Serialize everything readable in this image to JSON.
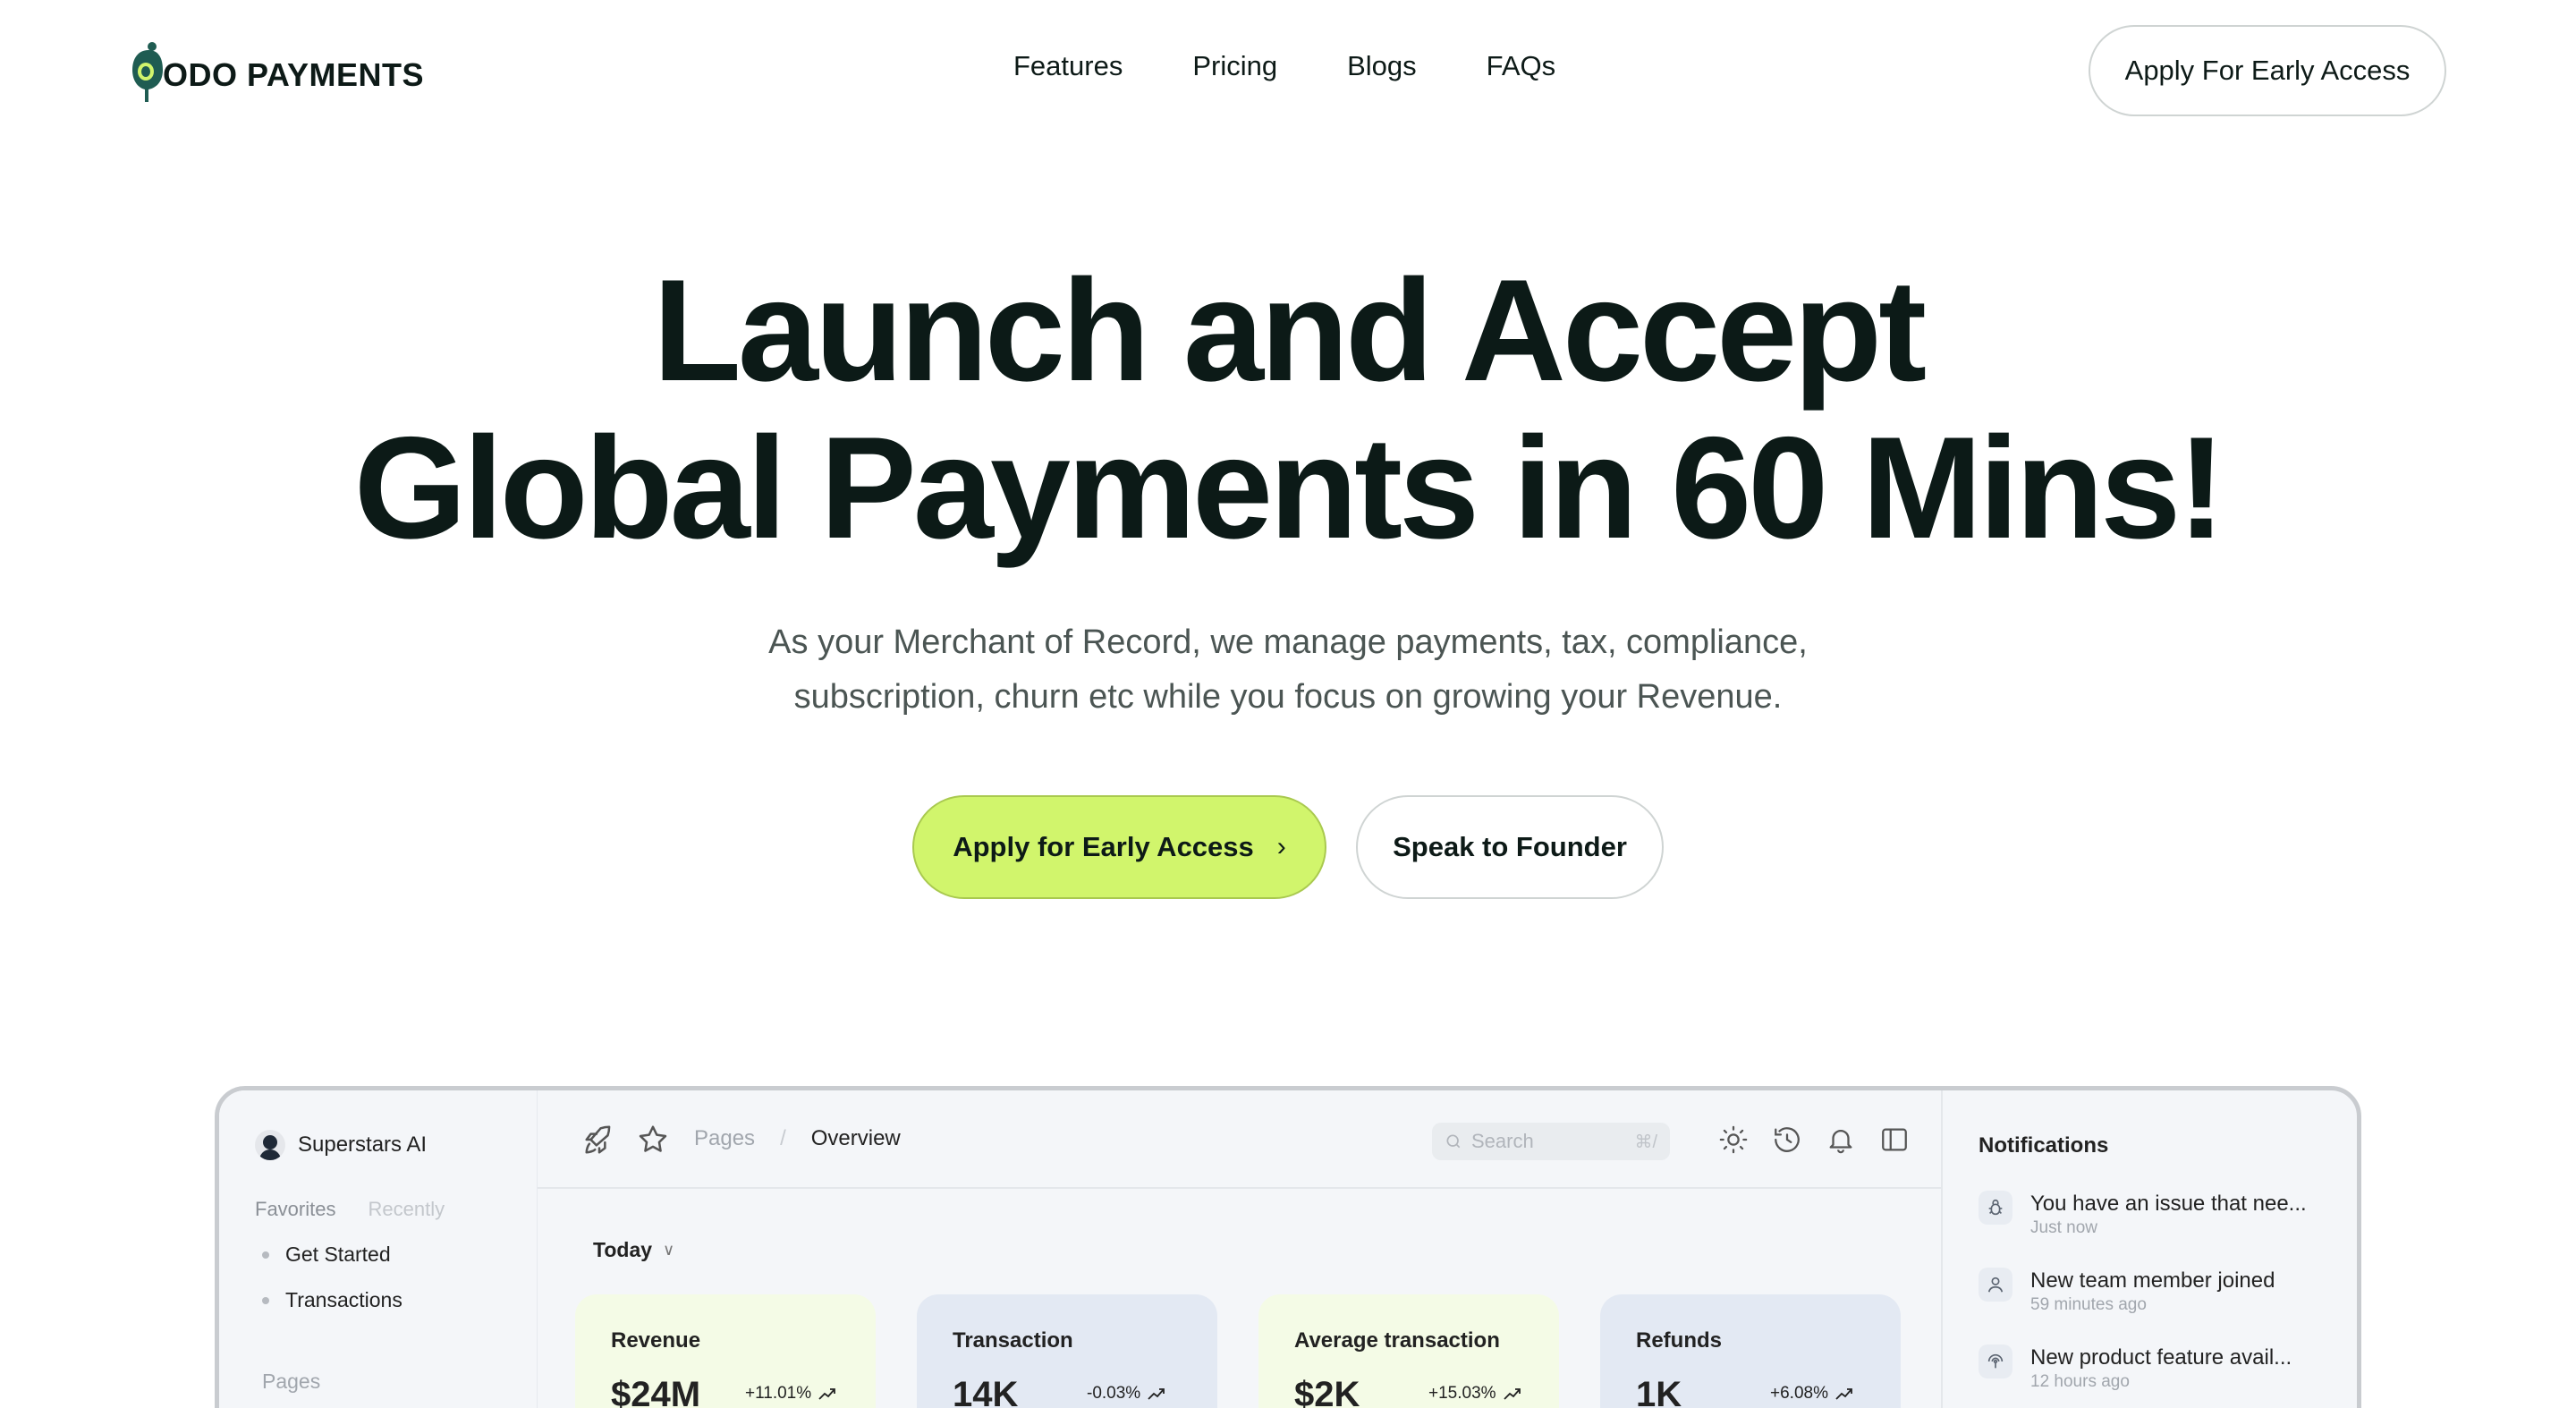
{
  "nav": {
    "logo_text": "ODO PAYMENTS",
    "links": [
      "Features",
      "Pricing",
      "Blogs",
      "FAQs"
    ],
    "cta_label": "Apply For Early Access"
  },
  "hero": {
    "title_line1": "Launch and Accept",
    "title_line2": "Global Payments in 60 Mins!",
    "subtitle_line1": "As your Merchant of Record, we manage payments, tax, compliance,",
    "subtitle_line2": "subscription, churn etc while you focus on growing your Revenue.",
    "primary_button": "Apply for Early Access",
    "secondary_button": "Speak to Founder"
  },
  "dashboard": {
    "workspace": "Superstars AI",
    "side_tabs": [
      "Favorites",
      "Recently"
    ],
    "side_items": [
      "Get Started",
      "Transactions"
    ],
    "side_heading": "Pages",
    "breadcrumb": [
      "Pages",
      "/",
      "Overview"
    ],
    "search_placeholder": "Search",
    "search_shortcut": "⌘/",
    "period": "Today",
    "cards": [
      {
        "label": "Revenue",
        "value": "$24M",
        "delta": "+11.01%",
        "color": "#f4fbe6"
      },
      {
        "label": "Transaction",
        "value": "14K",
        "delta": "-0.03%",
        "color": "#e3e9f3"
      },
      {
        "label": "Average transaction",
        "value": "$2K",
        "delta": "+15.03%",
        "color": "#f4fbe6"
      },
      {
        "label": "Refunds",
        "value": "1K",
        "delta": "+6.08%",
        "color": "#e3e9f3"
      }
    ],
    "notifications_title": "Notifications",
    "notifications": [
      {
        "text": "You have an issue that nee...",
        "time": "Just now",
        "icon": "bug-icon"
      },
      {
        "text": "New team member joined",
        "time": "59 minutes ago",
        "icon": "user-icon"
      },
      {
        "text": "New product feature avail...",
        "time": "12 hours ago",
        "icon": "broadcast-icon"
      }
    ]
  },
  "colors": {
    "primary_button_bg": "#d1f56c",
    "text_dark": "#0d1a17",
    "accent_green": "#1f5c52"
  }
}
